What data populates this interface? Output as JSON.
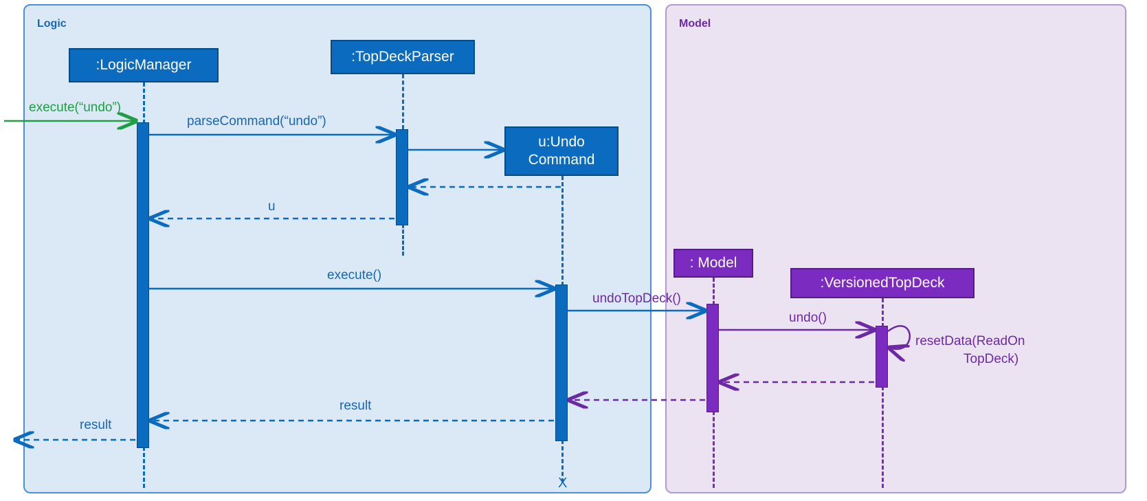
{
  "frames": {
    "logic": "Logic",
    "model": "Model"
  },
  "objects": {
    "logicManager": ":LogicManager",
    "parser": ":TopDeckParser",
    "undoCmd": "u:Undo\nCommand",
    "model": ": Model",
    "vtd": ":VersionedTopDeck"
  },
  "messages": {
    "executeUndo": "execute(“undo”)",
    "parseCommand": "parseCommand(“undo”)",
    "u": "u",
    "execute": "execute()",
    "undoTopDeck": "undoTopDeck()",
    "undo": "undo()",
    "resetData1": "resetData(ReadOn",
    "resetData2": "TopDeck)",
    "result1": "result",
    "result2": "result"
  },
  "termX": "X"
}
